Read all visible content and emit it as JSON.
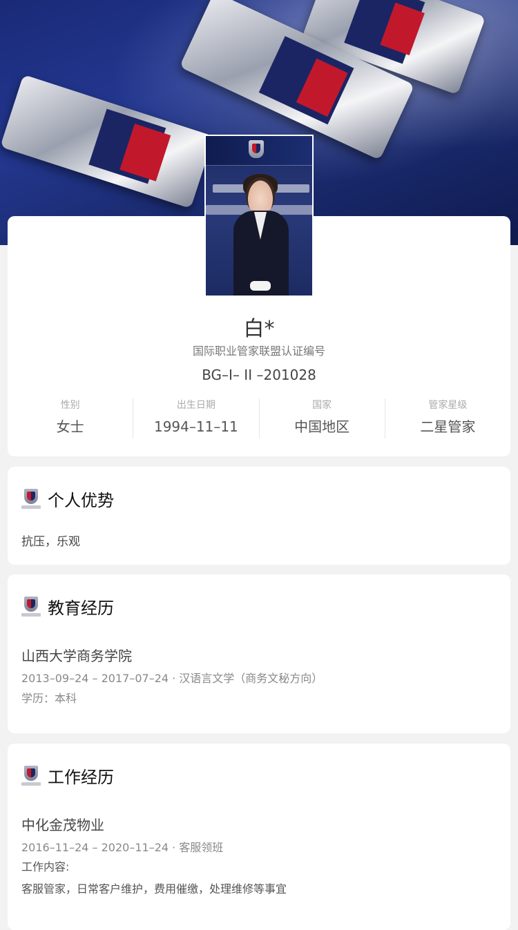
{
  "profile": {
    "name": "白*",
    "cert_label": "国际职业管家联盟认证编号",
    "cert_no": "BG–I– II –201028",
    "stats": [
      {
        "label": "性别",
        "value": "女士"
      },
      {
        "label": "出生日期",
        "value": "1994–11–11"
      },
      {
        "label": "国家",
        "value": "中国地区"
      },
      {
        "label": "管家星级",
        "value": "二星管家"
      }
    ]
  },
  "advantage": {
    "title": "个人优势",
    "text": "抗压，乐观"
  },
  "education": {
    "title": "教育经历",
    "school": "山西大学商务学院",
    "period_major": "2013–09–24 – 2017–07–24 · 汉语言文学（商务文秘方向）",
    "degree": "学历：本科"
  },
  "work": {
    "title": "工作经历",
    "company": "中化金茂物业",
    "period_role": "2016–11–24 – 2020–11–24 · 客服领班",
    "content_label": "工作内容:",
    "content": "客服管家，日常客户维护，费用催缴，处理维修等事宜"
  },
  "icons": {
    "section_logo": "academy-crest-icon",
    "avatar": "profile-photo"
  }
}
